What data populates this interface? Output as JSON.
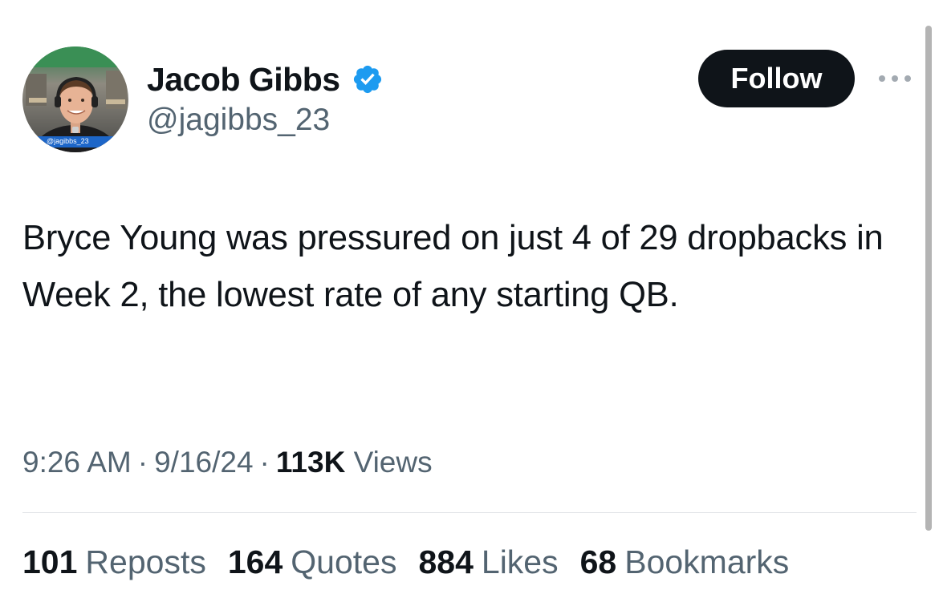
{
  "author": {
    "display_name": "Jacob Gibbs",
    "handle": "@jagibbs_23",
    "verified": true,
    "avatar_overlay_text": "@jagibbs_23"
  },
  "actions": {
    "follow_label": "Follow",
    "more_icon": "more-horizontal-icon"
  },
  "tweet": {
    "text": "Bryce Young was pressured on just 4 of 29 dropbacks in Week 2, the lowest rate of any starting QB.",
    "time": "9:26 AM",
    "date": "9/16/24",
    "separator": "·",
    "views_count": "113K",
    "views_label": "Views"
  },
  "stats": [
    {
      "count": "101",
      "label": "Reposts"
    },
    {
      "count": "164",
      "label": "Quotes"
    },
    {
      "count": "884",
      "label": "Likes"
    },
    {
      "count": "68",
      "label": "Bookmarks"
    }
  ],
  "colors": {
    "text_primary": "#0f1419",
    "text_secondary": "#536471",
    "verified_badge": "#1d9bf0",
    "follow_button_bg": "#0f1419",
    "follow_button_text": "#ffffff",
    "divider": "#e1e4e7"
  }
}
